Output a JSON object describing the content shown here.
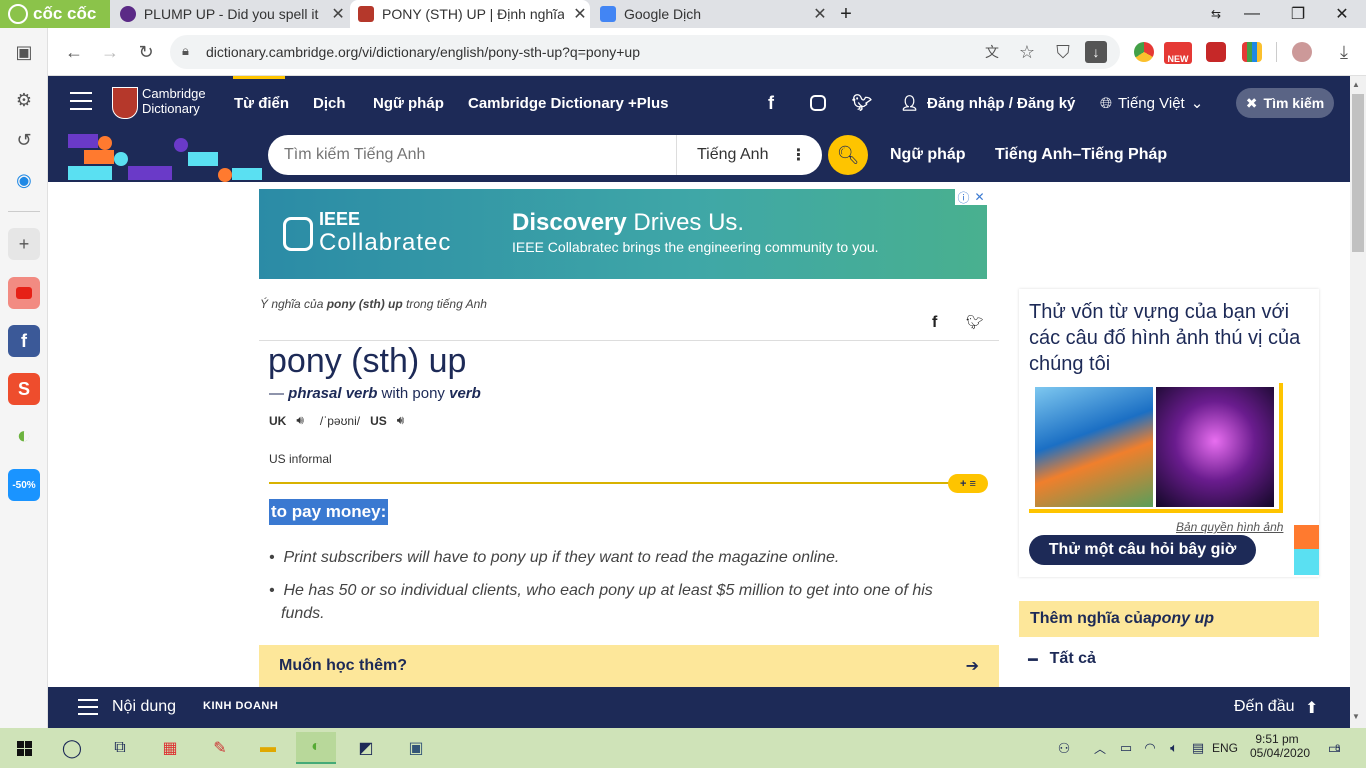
{
  "browser": {
    "brand_label": "cốc cốc",
    "tabs": [
      {
        "title": "PLUMP UP - Did you spell it c"
      },
      {
        "title": "PONY (STH) UP | Định nghĩa t"
      },
      {
        "title": "Google Dịch"
      }
    ],
    "new_tab": "+",
    "url": "dictionary.cambridge.org/vi/dictionary/english/pony-sth-up?q=pony+up",
    "ext_new_badge": "NEW"
  },
  "sidebar": {
    "tiki_badge": "-50%",
    "shopee_label": "S"
  },
  "site": {
    "logo_line1": "Cambridge",
    "logo_line2": "Dictionary",
    "nav": [
      "Từ điển",
      "Dịch",
      "Ngữ pháp",
      "Cambridge Dictionary +Plus"
    ],
    "login": "Đăng nhập / Đăng ký",
    "language": "Tiếng Việt",
    "search_pill": "Tìm kiếm"
  },
  "search": {
    "placeholder": "Tìm kiếm Tiếng Anh",
    "lang": "Tiếng Anh",
    "links": [
      "Ngữ pháp",
      "Tiếng Anh–Tiếng Pháp"
    ]
  },
  "ad": {
    "brand_top": "IEEE",
    "brand_bottom": "Collabratec",
    "headline_bold": "Discovery",
    "headline_rest": " Drives Us.",
    "sub": "IEEE Collabratec brings the engineering community to you."
  },
  "entry": {
    "crumb_prefix": "Ý nghĩa của ",
    "crumb_word": "pony (sth) up",
    "crumb_suffix": " trong tiếng Anh",
    "headword": "pony (sth) up",
    "pos_dash": "— ",
    "pos_type": "phrasal verb",
    "pos_with": " with pony ",
    "pos_verb": "verb",
    "uk": "UK",
    "ipa": "/ˈpəʊni/",
    "us": "US",
    "label": "US informal",
    "badge": "+ ≡",
    "definition": "to pay money:",
    "examples": [
      "Print subscribers will have to pony up if they want to read the magazine online.",
      "He has 50 or so individual clients, who each pony up at least $5 million to get into one of his funds."
    ],
    "learn_more": "Muốn học thêm?"
  },
  "quiz": {
    "title": "Thử vốn từ vựng của bạn với các câu đố hình ảnh thú vị của chúng tôi",
    "credit": "Bản quyền hình ảnh",
    "button": "Thử một câu hỏi bây giờ"
  },
  "more_meanings": {
    "prefix": "Thêm nghĩa của ",
    "word": "pony up",
    "all": "Tất cả"
  },
  "bottom_bar": {
    "contents": "Nội dung",
    "business": "KINH DOANH",
    "top": "Đến đầu"
  },
  "taskbar": {
    "lang": "ENG",
    "time": "9:51 pm",
    "date": "05/04/2020",
    "notif": "8"
  },
  "colors": {
    "cambridge_navy": "#1d2a57",
    "accent_yellow": "#fec400",
    "highlight_blue": "#3a79d1"
  }
}
